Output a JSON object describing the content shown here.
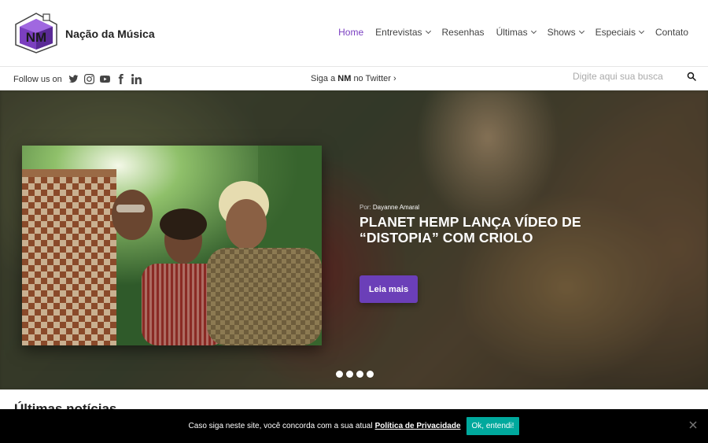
{
  "site": {
    "name": "Nação da Música",
    "logo_text": "NM"
  },
  "nav": {
    "items": [
      {
        "label": "Home",
        "active": true,
        "dropdown": false
      },
      {
        "label": "Entrevistas",
        "active": false,
        "dropdown": true
      },
      {
        "label": "Resenhas",
        "active": false,
        "dropdown": false
      },
      {
        "label": "Últimas",
        "active": false,
        "dropdown": true
      },
      {
        "label": "Shows",
        "active": false,
        "dropdown": true
      },
      {
        "label": "Especiais",
        "active": false,
        "dropdown": true
      },
      {
        "label": "Contato",
        "active": false,
        "dropdown": false
      }
    ]
  },
  "subbar": {
    "follow_label": "Follow us on",
    "social_icons": [
      "twitter-icon",
      "instagram-icon",
      "youtube-icon",
      "facebook-icon",
      "linkedin-icon"
    ],
    "twitter_prefix": "Siga a",
    "twitter_brand": "NM",
    "twitter_suffix": "no Twitter",
    "twitter_arrow": "›",
    "search_placeholder": "Digite aqui sua busca"
  },
  "hero": {
    "byline_prefix": "Por:",
    "author": "Dayanne Amaral",
    "title": "PLANET HEMP LANÇA VÍDEO DE “DISTOPIA” COM CRIOLO",
    "button": "Leia mais",
    "slide_count": 4
  },
  "section_peek": "Últimas notícias",
  "cookie": {
    "text": "Caso siga neste site, você concorda com a sua atual",
    "link": "Política de Privacidade",
    "button": "Ok, entendi!"
  },
  "colors": {
    "accent": "#7a3fc1",
    "button": "#6b3fb8",
    "cookie_button": "#00a99d"
  }
}
